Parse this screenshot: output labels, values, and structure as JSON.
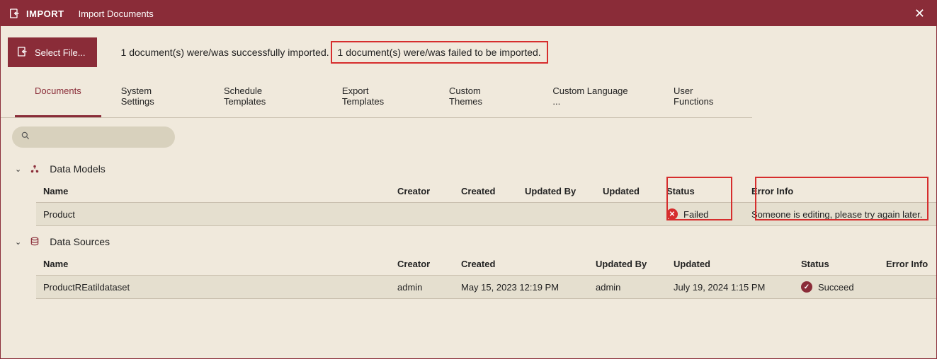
{
  "header": {
    "title": "IMPORT",
    "subtitle": "Import Documents"
  },
  "toolbar": {
    "select_file_label": "Select File...",
    "status_success": "1 document(s) were/was successfully imported.",
    "status_failed": "1 document(s) were/was failed to be imported."
  },
  "tabs": [
    {
      "label": "Documents",
      "active": true
    },
    {
      "label": "System Settings",
      "active": false
    },
    {
      "label": "Schedule Templates",
      "active": false
    },
    {
      "label": "Export Templates",
      "active": false
    },
    {
      "label": "Custom Themes",
      "active": false
    },
    {
      "label": "Custom Language ...",
      "active": false
    },
    {
      "label": "User Functions",
      "active": false
    }
  ],
  "search": {
    "placeholder": ""
  },
  "sections": {
    "data_models": {
      "title": "Data Models",
      "columns": [
        "Name",
        "Creator",
        "Created",
        "Updated By",
        "Updated",
        "Status",
        "Error Info"
      ],
      "rows": [
        {
          "name": "Product",
          "creator": "",
          "created": "",
          "updated_by": "",
          "updated": "",
          "status": "Failed",
          "status_type": "fail",
          "error_info": "Someone is editing, please try again later."
        }
      ]
    },
    "data_sources": {
      "title": "Data Sources",
      "columns": [
        "Name",
        "Creator",
        "Created",
        "Updated By",
        "Updated",
        "Status",
        "Error Info"
      ],
      "rows": [
        {
          "name": "ProductREatildataset",
          "creator": "admin",
          "created": "May 15, 2023 12:19 PM",
          "updated_by": "admin",
          "updated": "July 19, 2024 1:15 PM",
          "status": "Succeed",
          "status_type": "ok",
          "error_info": ""
        }
      ]
    }
  }
}
